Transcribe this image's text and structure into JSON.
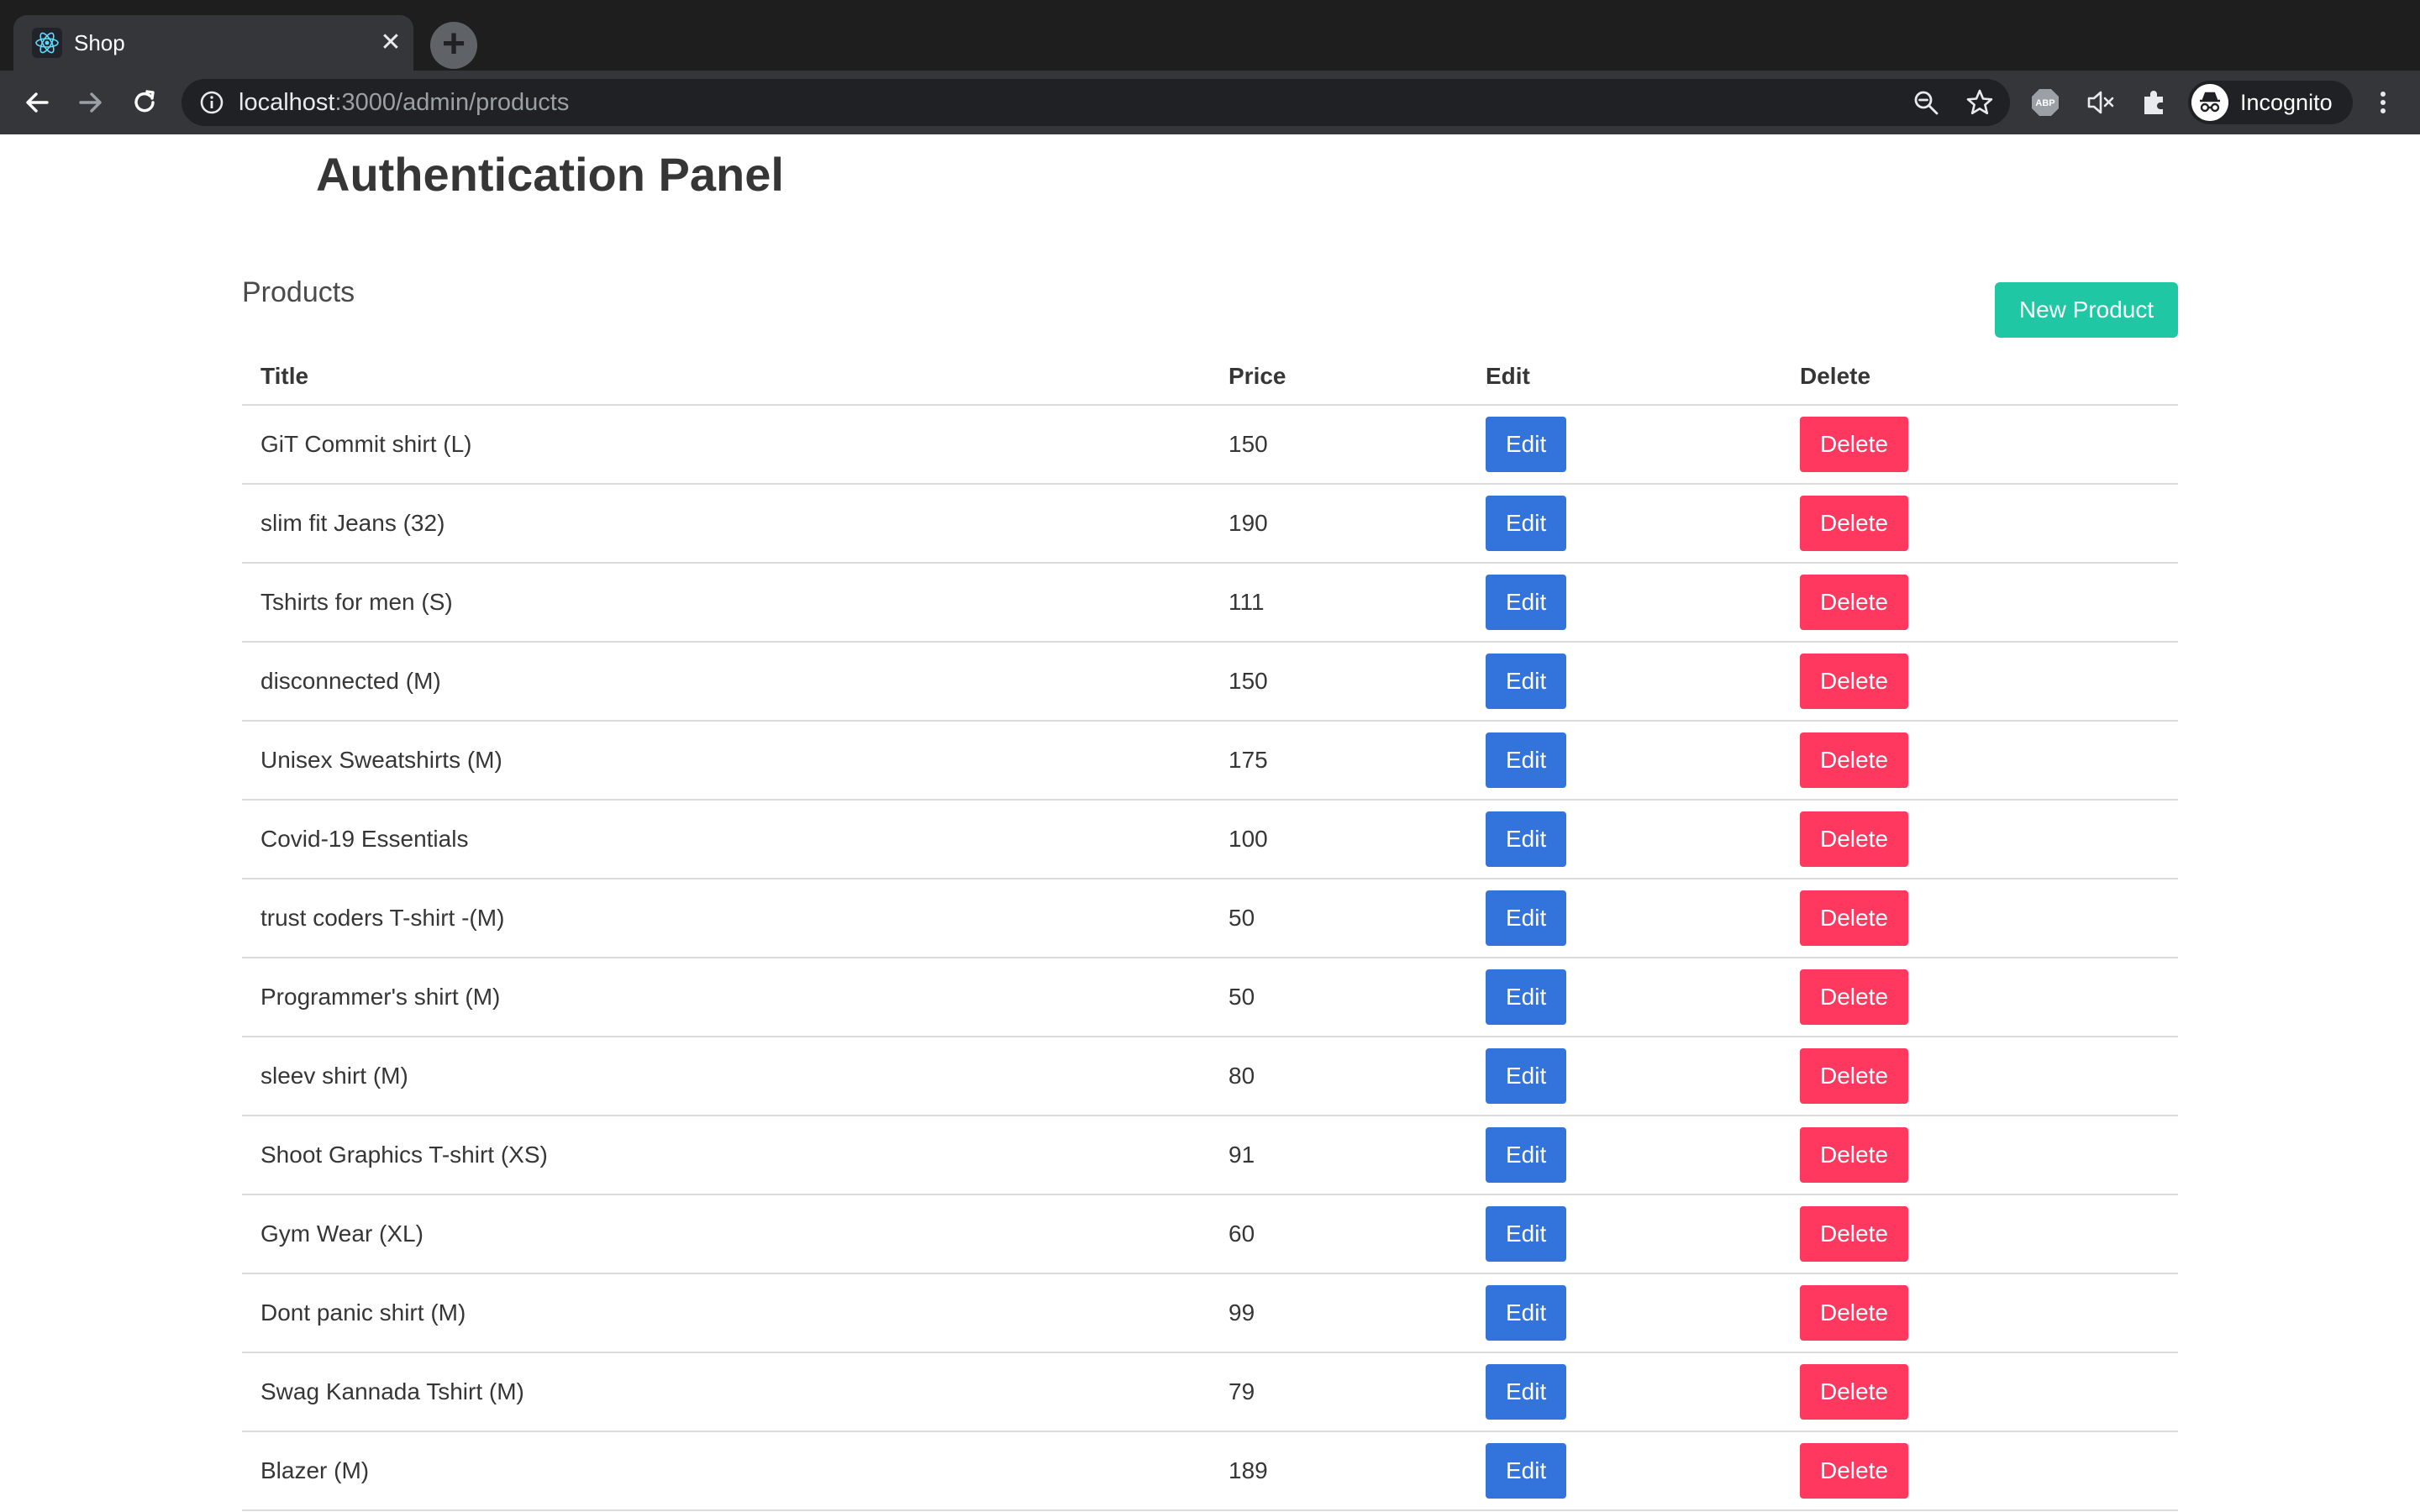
{
  "browser": {
    "tab_title": "Shop",
    "tab_close": "✕",
    "new_tab": "+",
    "url_host": "localhost",
    "url_path": ":3000/admin/products",
    "profile_label": "Incognito",
    "icons": [
      "react-icon",
      "back-arrow-icon",
      "forward-arrow-icon",
      "reload-icon",
      "info-icon",
      "zoom-icon",
      "star-icon",
      "abp-icon",
      "mute-icon",
      "extensions-icon",
      "incognito-icon",
      "menu-icon"
    ]
  },
  "page": {
    "title": "Authentication Panel",
    "section_title": "Products",
    "new_product_label": "New Product"
  },
  "table": {
    "headers": {
      "title": "Title",
      "price": "Price",
      "edit": "Edit",
      "delete": "Delete"
    },
    "rows": [
      {
        "title": "GiT Commit shirt (L)",
        "price": "150",
        "edit": "Edit",
        "delete": "Delete"
      },
      {
        "title": "slim fit Jeans (32)",
        "price": "190",
        "edit": "Edit",
        "delete": "Delete"
      },
      {
        "title": "Tshirts for men (S)",
        "price": "111",
        "edit": "Edit",
        "delete": "Delete"
      },
      {
        "title": "disconnected (M)",
        "price": "150",
        "edit": "Edit",
        "delete": "Delete"
      },
      {
        "title": "Unisex Sweatshirts (M)",
        "price": "175",
        "edit": "Edit",
        "delete": "Delete"
      },
      {
        "title": "Covid-19 Essentials",
        "price": "100",
        "edit": "Edit",
        "delete": "Delete"
      },
      {
        "title": "trust coders T-shirt -(M)",
        "price": "50",
        "edit": "Edit",
        "delete": "Delete"
      },
      {
        "title": "Programmer's shirt (M)",
        "price": "50",
        "edit": "Edit",
        "delete": "Delete"
      },
      {
        "title": "sleev shirt (M)",
        "price": "80",
        "edit": "Edit",
        "delete": "Delete"
      },
      {
        "title": "Shoot Graphics T-shirt (XS)",
        "price": "91",
        "edit": "Edit",
        "delete": "Delete"
      },
      {
        "title": "Gym Wear (XL)",
        "price": "60",
        "edit": "Edit",
        "delete": "Delete"
      },
      {
        "title": "Dont panic shirt (M)",
        "price": "99",
        "edit": "Edit",
        "delete": "Delete"
      },
      {
        "title": "Swag Kannada Tshirt (M)",
        "price": "79",
        "edit": "Edit",
        "delete": "Delete"
      },
      {
        "title": "Blazer (M)",
        "price": "189",
        "edit": "Edit",
        "delete": "Delete"
      }
    ]
  },
  "colors": {
    "edit_button": "#3273dc",
    "delete_button": "#ff3860",
    "new_product_button": "#1fc7a4",
    "chrome_dark": "#35363a"
  }
}
